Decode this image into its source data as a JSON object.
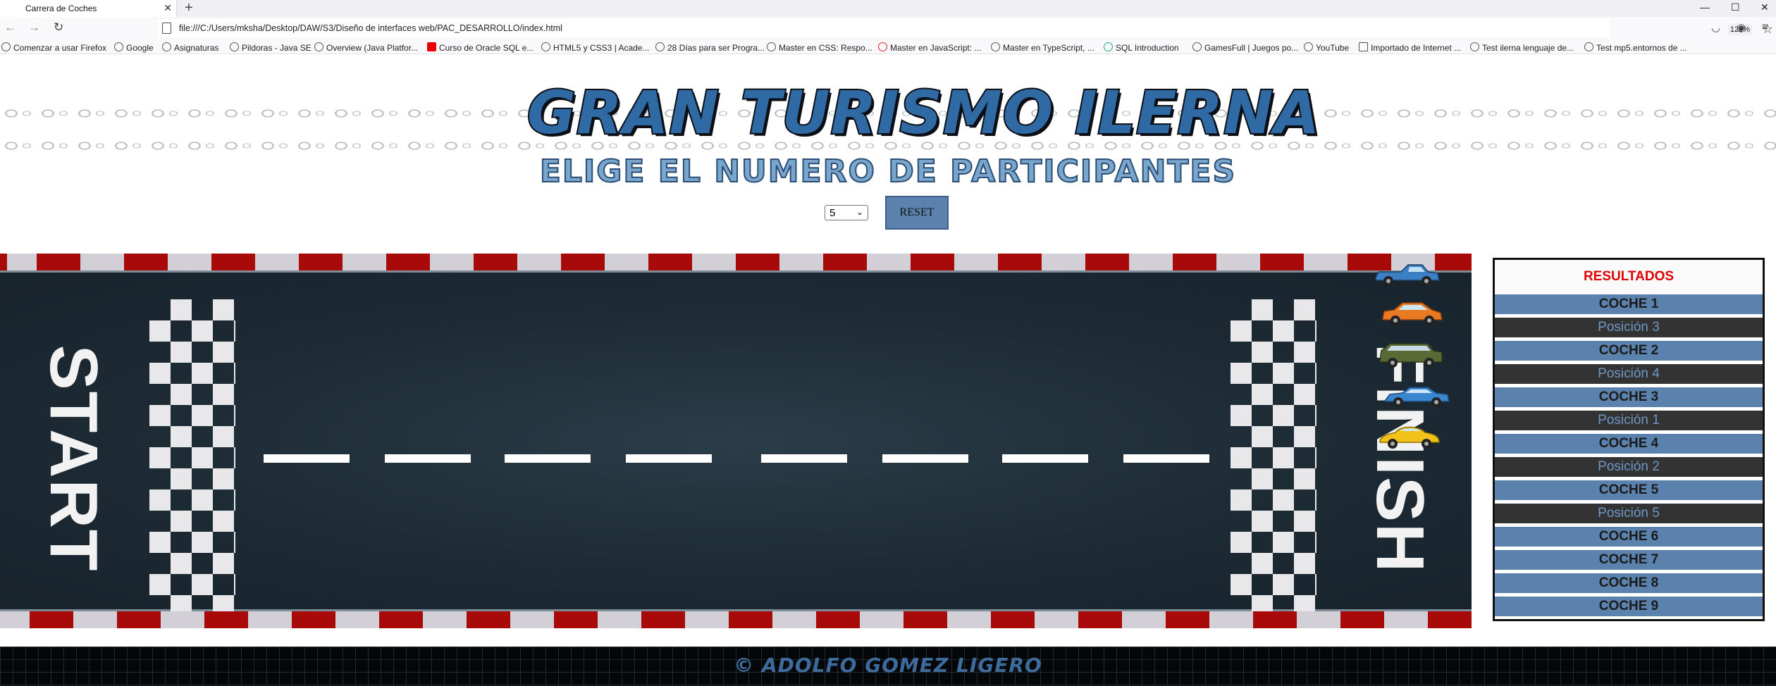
{
  "browser": {
    "tab_title": "Carrera de Coches",
    "url": "file:///C:/Users/mksha/Desktop/DAW/S3/Diseño de interfaces web/PAC_DESARROLLO/index.html",
    "zoom": "120%",
    "bookmarks": [
      "Comenzar a usar Firefox",
      "Google",
      "Asignaturas",
      "Pildoras - Java SE",
      "Overview (Java Platfor...",
      "Curso de Oracle SQL e...",
      "HTML5 y CSS3 | Acade...",
      "28 Días para ser Progra...",
      "Master en CSS: Respo...",
      "Master en JavaScript: ...",
      "Master en TypeScript, ...",
      "SQL Introduction",
      "GamesFull | Juegos po...",
      "YouTube",
      "Importado de Internet ...",
      "Test ilerna lenguaje de...",
      "Test mp5.entornos de ..."
    ]
  },
  "header": {
    "logo_text": "GRAN TURISMO ILERNA",
    "subtitle": "ELIGE EL NUMERO DE PARTICIPANTES",
    "participants_value": "5",
    "reset_label": "RESET"
  },
  "track": {
    "start_label": "START",
    "finish_label": "FINISH",
    "cars": [
      {
        "name": "pickup-car",
        "color": "#3b7fc4"
      },
      {
        "name": "hatchback-car",
        "color": "#e87a24"
      },
      {
        "name": "suv-car",
        "color": "#5a6a34"
      },
      {
        "name": "sedan-car",
        "color": "#3a86d0"
      },
      {
        "name": "beetle-car",
        "color": "#f2c21b"
      }
    ]
  },
  "results": {
    "title": "RESULTADOS",
    "rows": [
      {
        "type": "car",
        "label": "COCHE 1"
      },
      {
        "type": "pos",
        "label": "Posición 3"
      },
      {
        "type": "car",
        "label": "COCHE 2"
      },
      {
        "type": "pos",
        "label": "Posición 4"
      },
      {
        "type": "car",
        "label": "COCHE 3"
      },
      {
        "type": "pos",
        "label": "Posición 1"
      },
      {
        "type": "car",
        "label": "COCHE 4"
      },
      {
        "type": "pos",
        "label": "Posición 2"
      },
      {
        "type": "car",
        "label": "COCHE 5"
      },
      {
        "type": "pos",
        "label": "Posición 5"
      },
      {
        "type": "car",
        "label": "COCHE 6"
      },
      {
        "type": "car",
        "label": "COCHE 7"
      },
      {
        "type": "car",
        "label": "COCHE 8"
      },
      {
        "type": "car",
        "label": "COCHE 9"
      }
    ]
  },
  "footer": {
    "copyright": "© ADOLFO GOMEZ LIGERO"
  }
}
